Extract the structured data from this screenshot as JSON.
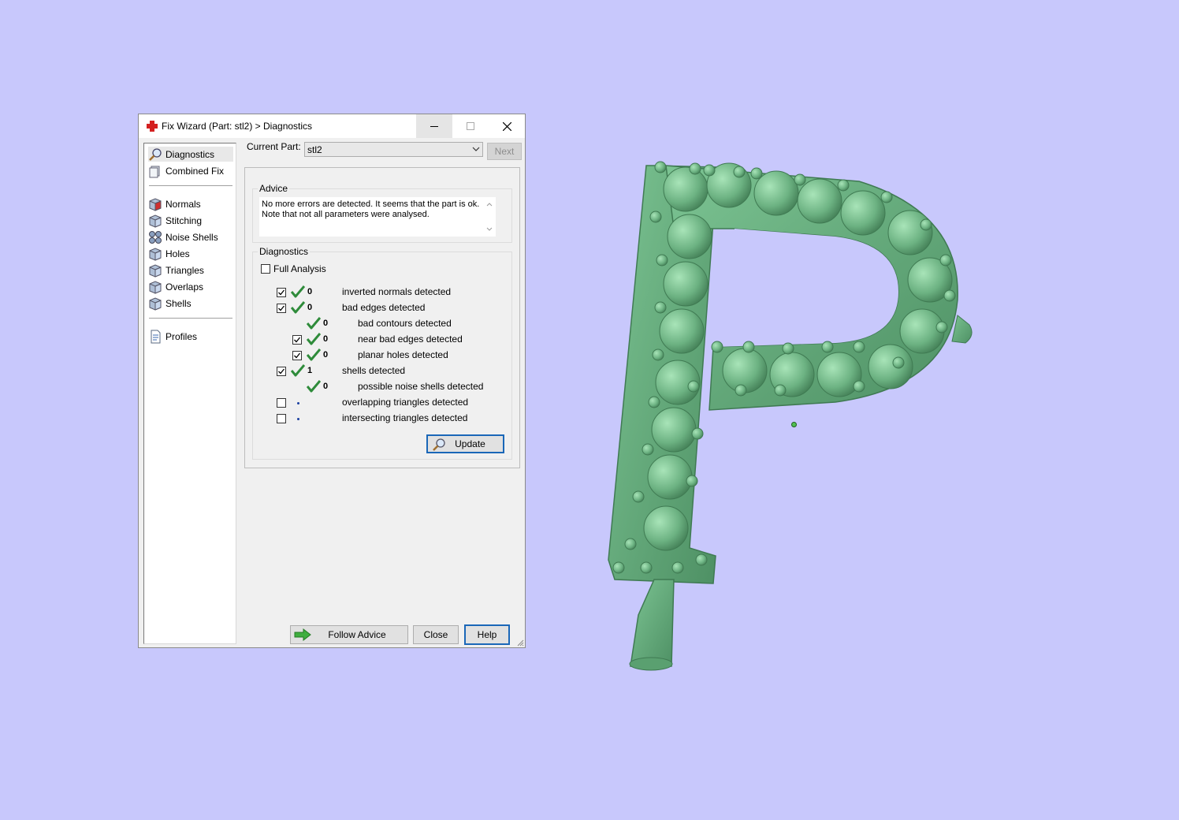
{
  "window": {
    "title": "Fix Wizard (Part: stl2) > Diagnostics",
    "buttons": {
      "minimize": "minimize",
      "maximize": "maximize",
      "close": "close"
    }
  },
  "sidebar": {
    "groups": [
      [
        {
          "label": "Diagnostics",
          "icon": "magnifier-icon",
          "selected": true
        },
        {
          "label": "Combined Fix",
          "icon": "combined-fix-icon"
        }
      ],
      [
        {
          "label": "Normals",
          "icon": "normals-cube-icon"
        },
        {
          "label": "Stitching",
          "icon": "stitching-cube-icon"
        },
        {
          "label": "Noise Shells",
          "icon": "noise-shells-icon"
        },
        {
          "label": "Holes",
          "icon": "holes-cube-icon"
        },
        {
          "label": "Triangles",
          "icon": "triangles-cube-icon"
        },
        {
          "label": "Overlaps",
          "icon": "overlaps-cube-icon"
        },
        {
          "label": "Shells",
          "icon": "shells-cube-icon"
        }
      ],
      [
        {
          "label": "Profiles",
          "icon": "profiles-document-icon"
        }
      ]
    ]
  },
  "current_part": {
    "label": "Current Part:",
    "value": "stl2",
    "next_button": "Next"
  },
  "advice": {
    "title": "Advice",
    "line1": "No more errors are detected. It seems that the part is ok.",
    "line2": "Note that not all parameters were analysed."
  },
  "diagnostics": {
    "title": "Diagnostics",
    "full_analysis": {
      "label": "Full Analysis",
      "checked": false
    },
    "rows": [
      {
        "checkbox": true,
        "checked": true,
        "status": "check",
        "count": "0",
        "label": "inverted normals detected",
        "indent": 0
      },
      {
        "checkbox": true,
        "checked": true,
        "status": "check",
        "count": "0",
        "label": "bad edges detected",
        "indent": 0
      },
      {
        "checkbox": false,
        "checked": false,
        "status": "check",
        "count": "0",
        "label": "bad contours detected",
        "indent": 1
      },
      {
        "checkbox": true,
        "checked": true,
        "status": "check",
        "count": "0",
        "label": "near bad edges detected",
        "indent": 1
      },
      {
        "checkbox": true,
        "checked": true,
        "status": "check",
        "count": "0",
        "label": "planar holes detected",
        "indent": 1
      },
      {
        "checkbox": true,
        "checked": true,
        "status": "check",
        "count": "1",
        "label": "shells detected",
        "indent": 0
      },
      {
        "checkbox": false,
        "checked": false,
        "status": "check",
        "count": "0",
        "label": "possible noise shells detected",
        "indent": 1
      },
      {
        "checkbox": true,
        "checked": false,
        "status": "dot",
        "count": "",
        "label": "overlapping triangles detected",
        "indent": 0
      },
      {
        "checkbox": true,
        "checked": false,
        "status": "dot",
        "count": "",
        "label": "intersecting triangles detected",
        "indent": 0
      }
    ],
    "update_button": "Update"
  },
  "footer": {
    "follow_advice": "Follow Advice",
    "close": "Close",
    "help": "Help"
  },
  "viewport": {
    "model": "letter P 3D model with spheres",
    "background": "#c8c8fc",
    "model_color": "#6cb282"
  }
}
